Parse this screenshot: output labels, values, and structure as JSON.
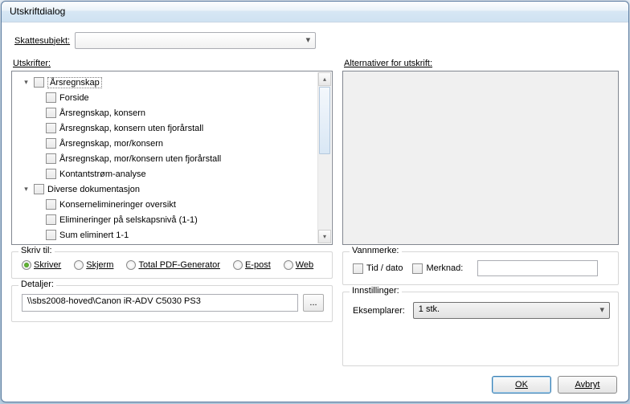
{
  "title": "Utskriftdialog",
  "top": {
    "label": "Skattesubjekt:"
  },
  "left": {
    "listLabel": "Utskrifter:",
    "tree": [
      {
        "level": 1,
        "twisty": "▾",
        "label": "Årsregnskap",
        "selected": true
      },
      {
        "level": 2,
        "label": "Forside"
      },
      {
        "level": 2,
        "label": "Årsregnskap, konsern"
      },
      {
        "level": 2,
        "label": "Årsregnskap, konsern uten fjorårstall"
      },
      {
        "level": 2,
        "label": "Årsregnskap, mor/konsern"
      },
      {
        "level": 2,
        "label": "Årsregnskap, mor/konsern uten fjorårstall"
      },
      {
        "level": 2,
        "label": "Kontantstrøm-analyse"
      },
      {
        "level": 1,
        "twisty": "▾",
        "label": "Diverse dokumentasjon"
      },
      {
        "level": 2,
        "label": "Konsernelimineringer oversikt"
      },
      {
        "level": 2,
        "label": "Elimineringer på selskapsnivå (1-1)"
      },
      {
        "level": 2,
        "label": "Sum eliminert 1-1"
      }
    ],
    "writeTo": {
      "legend": "Skriv til:",
      "options": [
        "Skriver",
        "Skjerm",
        "Total PDF-Generator",
        "E-post",
        "Web"
      ],
      "selected": "Skriver"
    },
    "details": {
      "legend": "Detaljer:",
      "value": "\\\\sbs2008-hoved\\Canon iR-ADV C5030 PS3",
      "browse": "..."
    }
  },
  "right": {
    "altLabel": "Alternativer for utskrift:",
    "watermark": {
      "legend": "Vannmerke:",
      "tidDato": "Tid / dato",
      "merknad": "Merknad:"
    },
    "settings": {
      "legend": "Innstillinger:",
      "copiesLabel": "Eksemplarer:",
      "copiesValue": "1 stk."
    }
  },
  "footer": {
    "ok": "OK",
    "cancel": "Avbryt"
  }
}
